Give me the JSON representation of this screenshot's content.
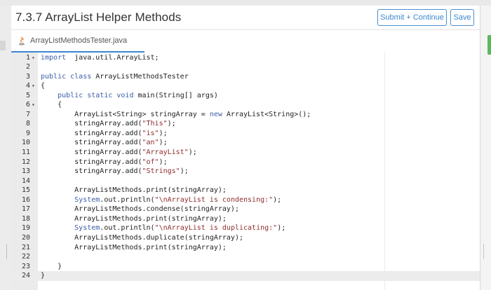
{
  "header": {
    "title": "7.3.7 ArrayList Helper Methods",
    "submit_label": "Submit + Continue",
    "save_label": "Save"
  },
  "tab": {
    "file_name": "ArrayListMethodsTester.java",
    "icon": "java-file-icon"
  },
  "editor": {
    "active_line": 24,
    "lines": [
      {
        "n": "1",
        "fold": "▾",
        "segs": [
          [
            "kw",
            "import"
          ],
          [
            "",
            "  java.util.ArrayList;"
          ]
        ]
      },
      {
        "n": "2",
        "fold": "",
        "segs": []
      },
      {
        "n": "3",
        "fold": "",
        "segs": [
          [
            "kw",
            "public class"
          ],
          [
            "",
            " ArrayListMethodsTester"
          ]
        ]
      },
      {
        "n": "4",
        "fold": "▾",
        "segs": [
          [
            "",
            "{"
          ]
        ]
      },
      {
        "n": "5",
        "fold": "",
        "segs": [
          [
            "",
            "    "
          ],
          [
            "kw",
            "public static void"
          ],
          [
            "",
            " main(String[] args)"
          ]
        ]
      },
      {
        "n": "6",
        "fold": "▾",
        "segs": [
          [
            "",
            "    {"
          ]
        ]
      },
      {
        "n": "7",
        "fold": "",
        "segs": [
          [
            "",
            "        ArrayList<String> stringArray = "
          ],
          [
            "kw",
            "new"
          ],
          [
            "",
            " ArrayList<String>();"
          ]
        ]
      },
      {
        "n": "8",
        "fold": "",
        "segs": [
          [
            "",
            "        stringArray.add("
          ],
          [
            "str",
            "\"This\""
          ],
          [
            "",
            ");"
          ]
        ]
      },
      {
        "n": "9",
        "fold": "",
        "segs": [
          [
            "",
            "        stringArray.add("
          ],
          [
            "str",
            "\"is\""
          ],
          [
            "",
            ");"
          ]
        ]
      },
      {
        "n": "10",
        "fold": "",
        "segs": [
          [
            "",
            "        stringArray.add("
          ],
          [
            "str",
            "\"an\""
          ],
          [
            "",
            ");"
          ]
        ]
      },
      {
        "n": "11",
        "fold": "",
        "segs": [
          [
            "",
            "        stringArray.add("
          ],
          [
            "str",
            "\"ArrayList\""
          ],
          [
            "",
            ");"
          ]
        ]
      },
      {
        "n": "12",
        "fold": "",
        "segs": [
          [
            "",
            "        stringArray.add("
          ],
          [
            "str",
            "\"of\""
          ],
          [
            "",
            ");"
          ]
        ]
      },
      {
        "n": "13",
        "fold": "",
        "segs": [
          [
            "",
            "        stringArray.add("
          ],
          [
            "str",
            "\"Strings\""
          ],
          [
            "",
            ");"
          ]
        ]
      },
      {
        "n": "14",
        "fold": "",
        "segs": []
      },
      {
        "n": "15",
        "fold": "",
        "segs": [
          [
            "",
            "        ArrayListMethods.print(stringArray);"
          ]
        ]
      },
      {
        "n": "16",
        "fold": "",
        "segs": [
          [
            "kw",
            "        System"
          ],
          [
            "",
            ".out.println("
          ],
          [
            "str",
            "\"\\nArrayList is condensing:\""
          ],
          [
            "",
            ");"
          ]
        ]
      },
      {
        "n": "17",
        "fold": "",
        "segs": [
          [
            "",
            "        ArrayListMethods.condense(stringArray);"
          ]
        ]
      },
      {
        "n": "18",
        "fold": "",
        "segs": [
          [
            "",
            "        ArrayListMethods.print(stringArray);"
          ]
        ]
      },
      {
        "n": "19",
        "fold": "",
        "segs": [
          [
            "kw",
            "        System"
          ],
          [
            "",
            ".out.println("
          ],
          [
            "str",
            "\"\\nArrayList is duplicating:\""
          ],
          [
            "",
            ");"
          ]
        ]
      },
      {
        "n": "20",
        "fold": "",
        "segs": [
          [
            "",
            "        ArrayListMethods.duplicate(stringArray);"
          ]
        ]
      },
      {
        "n": "21",
        "fold": "",
        "segs": [
          [
            "",
            "        ArrayListMethods.print(stringArray);"
          ]
        ]
      },
      {
        "n": "22",
        "fold": "",
        "segs": []
      },
      {
        "n": "23",
        "fold": "",
        "segs": [
          [
            "",
            "    }"
          ]
        ]
      },
      {
        "n": "24",
        "fold": "",
        "segs": [
          [
            "",
            "}"
          ]
        ]
      }
    ]
  },
  "colors": {
    "accent": "#3d86cf",
    "keyword": "#3a5da8",
    "string": "#8d2d2d",
    "status_green": "#5cb85c"
  }
}
